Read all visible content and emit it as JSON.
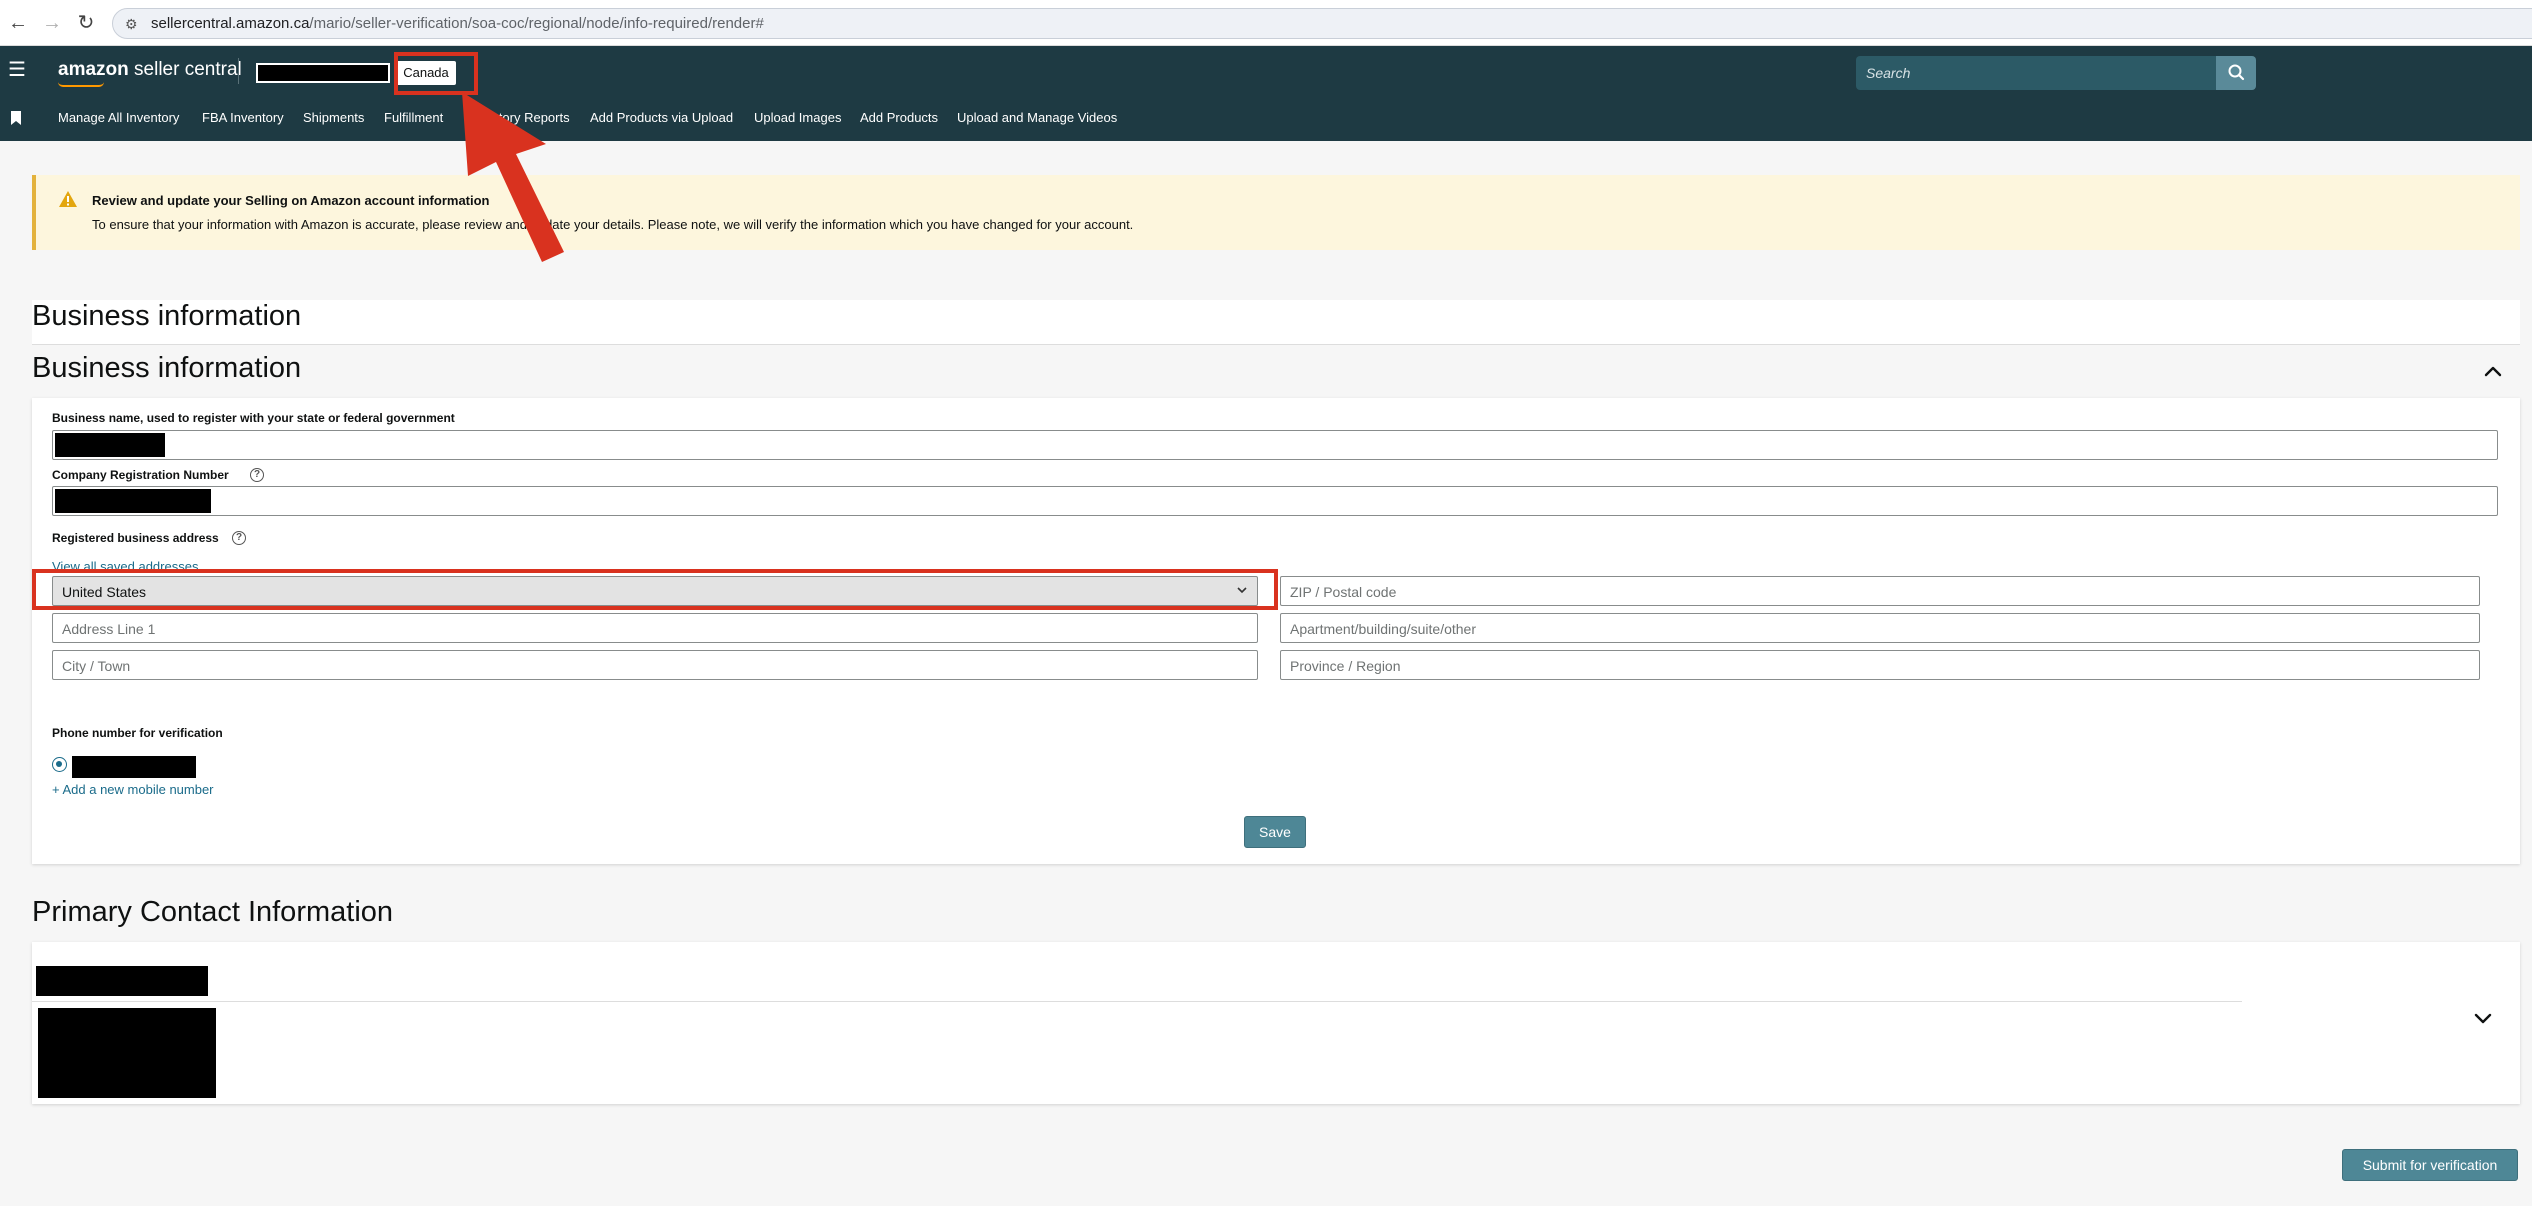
{
  "browser": {
    "url_host": "sellercentral.amazon.ca",
    "url_path": "/mario/seller-verification/soa-coc/regional/node/info-required/render#",
    "back_icon": "arrow-left-icon",
    "forward_icon": "arrow-right-icon",
    "reload_icon": "reload-icon"
  },
  "header": {
    "logo_brand": "amazon",
    "logo_product": " seller central",
    "marketplace": "Canada",
    "search_placeholder": "Search",
    "accent_color": "#ff9900",
    "nav_bg": "#1e3a43"
  },
  "subnav": {
    "items": [
      "Manage All Inventory",
      "FBA Inventory",
      "Shipments",
      "Fulfillment",
      "Inventory Reports",
      "Add Products via Upload",
      "Upload Images",
      "Add Products",
      "Upload and Manage Videos"
    ]
  },
  "alert": {
    "title": "Review and update your Selling on Amazon account information",
    "body": "To ensure that your information with Amazon is accurate, please review and update your details. Please note, we will verify the information which you have changed for your account."
  },
  "business": {
    "outer_heading": "Business information",
    "inner_heading": "Business information",
    "business_name_label": "Business name, used to register with your state or federal government",
    "company_reg_label": "Company Registration Number",
    "address_label": "Registered business address",
    "view_saved_link": "View all saved addresses",
    "country_value": "United States",
    "zip_placeholder": "ZIP / Postal code",
    "address1_placeholder": "Address Line 1",
    "apartment_placeholder": "Apartment/building/suite/other",
    "city_placeholder": "City / Town",
    "province_placeholder": "Province / Region",
    "phone_label": "Phone number for verification",
    "add_mobile_link": "+ Add a new mobile number",
    "save_label": "Save"
  },
  "contact": {
    "heading": "Primary Contact Information"
  },
  "footer": {
    "submit_label": "Submit for verification"
  },
  "colors": {
    "button": "#4e8796",
    "link": "#1a6b8a",
    "alert_bg": "#fdf6dd",
    "annotation_red": "#d9321f"
  }
}
